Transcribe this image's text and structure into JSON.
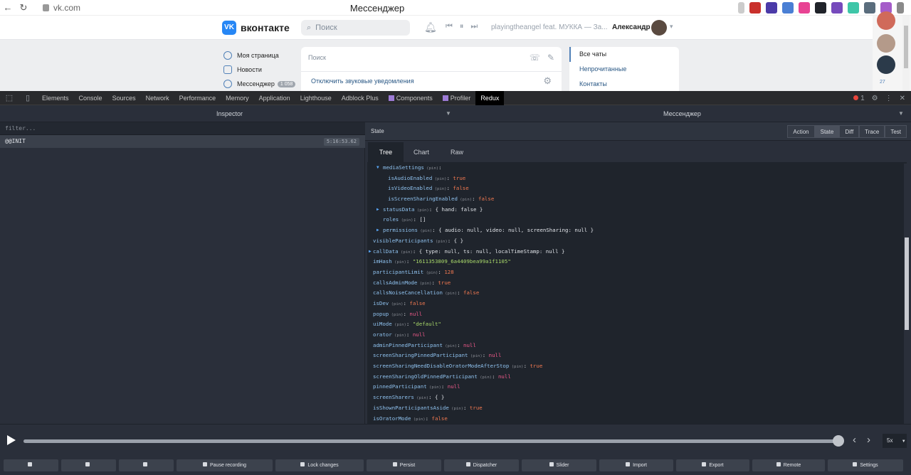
{
  "browser": {
    "url": "vk.com",
    "title": "Мессенджер"
  },
  "vk": {
    "logo": "вконтакте",
    "search_placeholder": "Поиск",
    "track": "playingtheangel feat. МУККА — За...",
    "user_name": "Александр",
    "sidebar": [
      {
        "label": "Моя страница"
      },
      {
        "label": "Новости"
      },
      {
        "label": "Мессенджер",
        "badge": "1 058"
      }
    ],
    "messenger": {
      "search_placeholder": "Поиск",
      "mute_link": "Отключить звуковые уведомления"
    },
    "filters": [
      "Все чаты",
      "Непрочитанные",
      "Контакты"
    ],
    "right_count": "27"
  },
  "devtools": {
    "tabs": [
      "Elements",
      "Console",
      "Sources",
      "Network",
      "Performance",
      "Memory",
      "Application",
      "Lighthouse",
      "Adblock Plus",
      "Components",
      "Profiler",
      "Redux"
    ],
    "active_tab": "Redux",
    "error_count": "1"
  },
  "redux": {
    "left_title": "Inspector",
    "right_title": "Мессенджер",
    "filter_placeholder": "filter...",
    "action_name": "@@INIT",
    "action_time": "5:16:53.62",
    "state_label": "State",
    "monitor_buttons": [
      "Action",
      "State",
      "Diff",
      "Trace",
      "Test"
    ],
    "active_monitor": "State",
    "subtabs": [
      "Tree",
      "Chart",
      "Raw"
    ],
    "active_subtab": "Tree",
    "pin": "(pin)",
    "tree": [
      {
        "indent": 1,
        "arrow": "▼",
        "key": "mediaSettings",
        "value": "",
        "type": "o"
      },
      {
        "indent": 2,
        "arrow": "",
        "key": "isAudioEnabled",
        "value": "true",
        "type": "b"
      },
      {
        "indent": 2,
        "arrow": "",
        "key": "isVideoEnabled",
        "value": "false",
        "type": "b"
      },
      {
        "indent": 2,
        "arrow": "",
        "key": "isScreenSharingEnabled",
        "value": "false",
        "type": "b"
      },
      {
        "indent": 1,
        "arrow": "▶",
        "key": "statusData",
        "value": "{ hand: false }",
        "type": "o"
      },
      {
        "indent": 1,
        "arrow": "",
        "key": "roles",
        "value": "[]",
        "type": "o"
      },
      {
        "indent": 1,
        "arrow": "▶",
        "key": "permissions",
        "value": "{ audio: null, video: null, screenSharing: null }",
        "type": "o"
      },
      {
        "indent": 0,
        "arrow": "",
        "key": "visibleParticipants",
        "value": "{ }",
        "type": "o"
      },
      {
        "indent": 0,
        "arrow": "▶",
        "key": "callData",
        "value": "{ type: null, ts: null, localTimeStamp: null }",
        "type": "o"
      },
      {
        "indent": 0,
        "arrow": "",
        "key": "imHash",
        "value": "\"1611353809_6a4409bea99a1f1105\"",
        "type": "s"
      },
      {
        "indent": 0,
        "arrow": "",
        "key": "participantLimit",
        "value": "128",
        "type": "n"
      },
      {
        "indent": 0,
        "arrow": "",
        "key": "callsAdminMode",
        "value": "true",
        "type": "b"
      },
      {
        "indent": 0,
        "arrow": "",
        "key": "callsNoiseCancellation",
        "value": "false",
        "type": "b"
      },
      {
        "indent": 0,
        "arrow": "",
        "key": "isDev",
        "value": "false",
        "type": "b"
      },
      {
        "indent": 0,
        "arrow": "",
        "key": "popup",
        "value": "null",
        "type": "nl"
      },
      {
        "indent": 0,
        "arrow": "",
        "key": "uiMode",
        "value": "\"default\"",
        "type": "s"
      },
      {
        "indent": 0,
        "arrow": "",
        "key": "orator",
        "value": "null",
        "type": "nl"
      },
      {
        "indent": 0,
        "arrow": "",
        "key": "adminPinnedParticipant",
        "value": "null",
        "type": "nl"
      },
      {
        "indent": 0,
        "arrow": "",
        "key": "screenSharingPinnedParticipant",
        "value": "null",
        "type": "nl"
      },
      {
        "indent": 0,
        "arrow": "",
        "key": "screenSharingNeedDisableOratorModeAfterStop",
        "value": "true",
        "type": "b"
      },
      {
        "indent": 0,
        "arrow": "",
        "key": "screenSharingOldPinnedParticipant",
        "value": "null",
        "type": "nl"
      },
      {
        "indent": 0,
        "arrow": "",
        "key": "pinnedParticipant",
        "value": "null",
        "type": "nl"
      },
      {
        "indent": 0,
        "arrow": "",
        "key": "screenSharers",
        "value": "{ }",
        "type": "o"
      },
      {
        "indent": 0,
        "arrow": "",
        "key": "isShownParticipantsAside",
        "value": "true",
        "type": "b"
      },
      {
        "indent": 0,
        "arrow": "",
        "key": "isOratorMode",
        "value": "false",
        "type": "b"
      }
    ],
    "speed": "5x",
    "slider_progress": 1.0,
    "buttons": [
      "",
      "",
      "",
      "Pause recording",
      "Lock changes",
      "Persist",
      "Dispatcher",
      "Slider",
      "Import",
      "Export",
      "Remote",
      "Settings"
    ]
  }
}
